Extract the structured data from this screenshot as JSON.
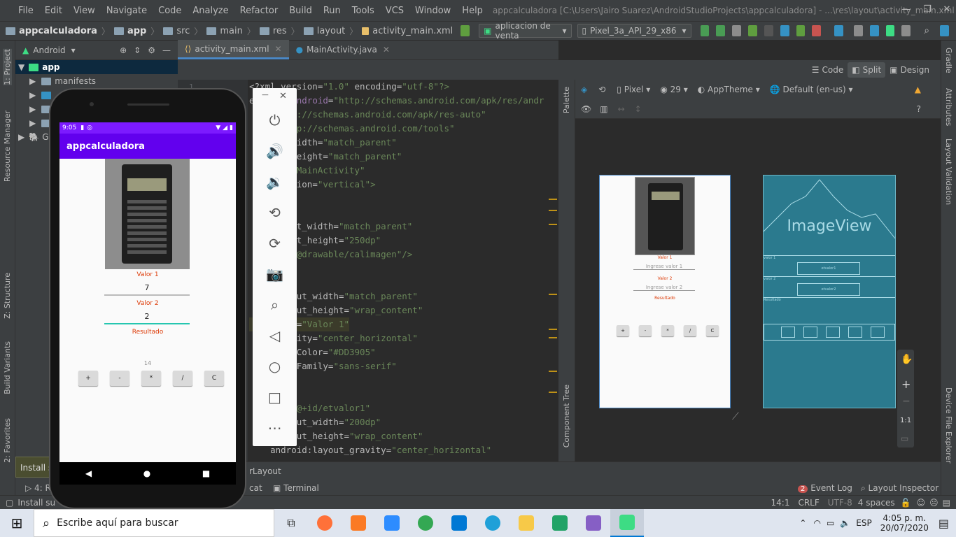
{
  "window": {
    "menu": [
      "File",
      "Edit",
      "View",
      "Navigate",
      "Code",
      "Analyze",
      "Refactor",
      "Build",
      "Run",
      "Tools",
      "VCS",
      "Window",
      "Help"
    ],
    "title": "appcalculadora [C:\\Users\\Jairo Suarez\\AndroidStudioProjects\\appcalculadora] - ...\\res\\layout\\activity_main.xml [app]"
  },
  "breadcrumb": [
    "appcalculadora",
    "app",
    "src",
    "main",
    "res",
    "layout",
    "activity_main.xml"
  ],
  "toolbar": {
    "run_config": "aplicacion de venta",
    "device": "Pixel_3a_API_29_x86"
  },
  "project": {
    "view_label": "Android",
    "root": "app",
    "items": [
      "manifests"
    ],
    "gradle_abbr": "G"
  },
  "left_tools": [
    "1: Project",
    "Resource Manager",
    "Z: Structure",
    "Build Variants",
    "2: Favorites"
  ],
  "right_tools": [
    "Gradle",
    "Attributes",
    "Layout Validation",
    "Device File Explorer"
  ],
  "editor": {
    "tabs": [
      "activity_main.xml",
      "MainActivity.java"
    ],
    "gutter_first_line": "1",
    "lines": [
      {
        "p1": "<?xml version=",
        "p2": "\"1.0\"",
        "p3": " encoding=",
        "p4": "\"utf-8\"",
        "p5": "?>"
      },
      {
        "p1": "ea",
        "p2": "xmlns:",
        "p3": "android",
        "p4": "=",
        "p5": "\"http://schemas.android.com/apk/res/andr"
      },
      {
        "p1": "",
        "p2": "",
        "p3": "",
        "p4": "",
        "p5": "\"http://schemas.android.com/apk/res-auto\""
      },
      {
        "p1": "",
        "p2": "",
        "p3": "",
        "p4": "=",
        "p5": "\"http://schemas.android.com/tools\""
      },
      {
        "p1": "",
        "p2": "",
        "p3": "out_width",
        "p4": "=",
        "p5": "\"match_parent\""
      },
      {
        "p1": "",
        "p2": "",
        "p3": "out_height",
        "p4": "=",
        "p5": "\"match_parent\""
      },
      {
        "p1": "",
        "p2": "",
        "p3": "xt",
        "p4": "=",
        "p5": "\".MainActivity\""
      },
      {
        "p1": "",
        "p2": "",
        "p3": "entation",
        "p4": "=",
        "p5": "\"vertical\">"
      },
      {
        "p1": "",
        "p2": "",
        "p3": "",
        "p4": "",
        "p5": ""
      },
      {
        "p1": "",
        "p2": "",
        "p3": "",
        "p4": "",
        "p5": ""
      },
      {
        "p1": "",
        "p2": "",
        "p3": "layout_width",
        "p4": "=",
        "p5": "\"match_parent\""
      },
      {
        "p1": "",
        "p2": "",
        "p3": "layout_height",
        "p4": "=",
        "p5": "\"250dp\""
      },
      {
        "p1": "",
        "p2": "",
        "p3": "src",
        "p4": "=",
        "p5": "\"@drawable/calimagen\"/>"
      },
      {
        "p1": "",
        "p2": "",
        "p3": "",
        "p4": "",
        "p5": ""
      },
      {
        "p1": "",
        "p2": "",
        "p3": "",
        "p4": "",
        "p5": ""
      },
      {
        "p1": "",
        "p2": "",
        "p3": ":layout_width",
        "p4": "=",
        "p5": "\"match_parent\""
      },
      {
        "p1": "",
        "p2": "",
        "p3": ":layout_height",
        "p4": "=",
        "p5": "\"wrap_content\""
      },
      {
        "p1": "",
        "p2": "",
        "p3": ":text",
        "p4": "=",
        "p5": "\"Valor 1\""
      },
      {
        "p1": "",
        "p2": "",
        "p3": ":gravity",
        "p4": "=",
        "p5": "\"center_horizontal\""
      },
      {
        "p1": "",
        "p2": "",
        "p3": ":textColor",
        "p4": "=",
        "p5": "\"#DD3905\""
      },
      {
        "p1": "",
        "p2": "",
        "p3": ":fontFamily",
        "p4": "=",
        "p5": "\"sans-serif\""
      },
      {
        "p1": "",
        "p2": "",
        "p3": "",
        "p4": "",
        "p5": ""
      },
      {
        "p1": "",
        "p2": "",
        "p3": "",
        "p4": "",
        "p5": ""
      },
      {
        "p1": "",
        "p2": "",
        "p3": ":id",
        "p4": "=",
        "p5": "\"@+id/etvalor1\""
      },
      {
        "p1": "",
        "p2": "",
        "p3": ":layout_width",
        "p4": "=",
        "p5": "\"200dp\""
      },
      {
        "p1": "",
        "p2": "",
        "p3": ":layout_height",
        "p4": "=",
        "p5": "\"wrap_content\""
      },
      {
        "p1": "android",
        "p2": "",
        "p3": ":layout_gravity",
        "p4": "=",
        "p5": "\"center_horizontal\""
      }
    ]
  },
  "design": {
    "modes": [
      "Code",
      "Split",
      "Design"
    ],
    "device": "Pixel",
    "api": "29",
    "theme": "AppTheme",
    "locale": "Default (en-us)",
    "palette": "Palette",
    "component_tree": "Component Tree",
    "preview": {
      "label1": "Valor 1",
      "hint1": "Ingrese valor 1",
      "label2": "Valor 2",
      "hint2": "Ingrese valor 2",
      "result": "Resultado",
      "buttons": [
        "+",
        "-",
        "*",
        "/",
        "C"
      ]
    },
    "blueprint": {
      "image_label": "ImageView",
      "label1": "valor 1",
      "field1": "etvalor1",
      "label2": "valor 2",
      "field2": "etvalor2",
      "result": "Resultado"
    },
    "zoom_fit": "1:1"
  },
  "emulator": {
    "time": "9:05",
    "app_title": "appcalculadora",
    "label1": "Valor 1",
    "value1": "7",
    "label2": "Valor 2",
    "value2": "2",
    "result_label": "Resultado",
    "result_value": "14",
    "buttons": [
      "+",
      "-",
      "*",
      "/",
      "C"
    ],
    "accent": "#7c1aff",
    "label_color": "#DD3905"
  },
  "bottom": {
    "tooltip": "Install s",
    "run_tab": "4: Ru",
    "logcat": "cat",
    "terminal": "Terminal",
    "layout_tab": "rLayout",
    "event_log_count": "2",
    "event_log": "Event Log",
    "layout_inspector": "Layout Inspector"
  },
  "status": {
    "message": "Install su",
    "position": "14:1",
    "line_ending": "CRLF",
    "encoding": "UTF-8",
    "indent": "4 spaces"
  },
  "taskbar": {
    "search_placeholder": "Escribe aquí para buscar",
    "lang": "ESP",
    "time": "4:05 p. m.",
    "date": "20/07/2020"
  }
}
